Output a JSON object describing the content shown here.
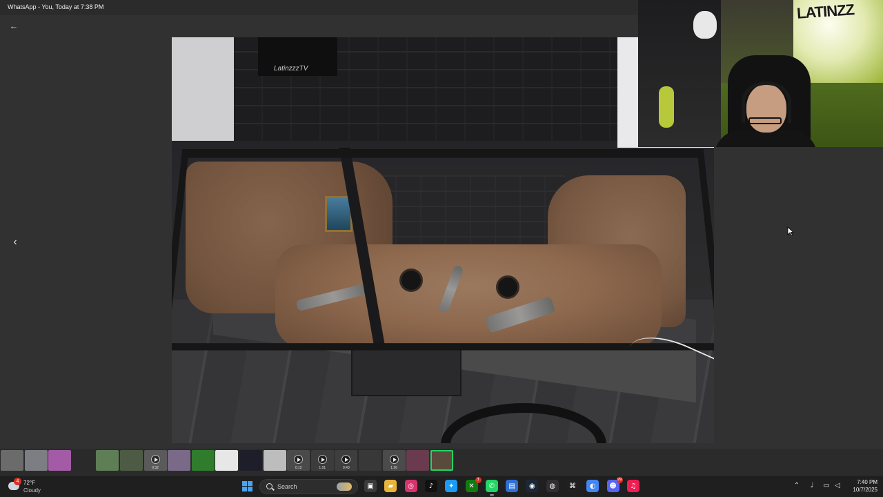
{
  "window": {
    "title": "WhatsApp - You, Today at 7:38 PM"
  },
  "viewer": {
    "back_icon": "arrow-left-icon",
    "prev_icon": "chevron-left-icon",
    "photo_poster_text": "LatinzzzTV"
  },
  "webcam": {
    "graffiti_text": "LATINZZ"
  },
  "thumbnails": [
    {
      "kind": "image",
      "color": "#6b6b6b"
    },
    {
      "kind": "image",
      "color": "#7d7d84"
    },
    {
      "kind": "image",
      "color": "#a45ba6"
    },
    {
      "kind": "image",
      "color": "#2a2a2a"
    },
    {
      "kind": "image",
      "color": "#5e7f55"
    },
    {
      "kind": "image",
      "color": "#4d5b44"
    },
    {
      "kind": "video",
      "duration": "0:32",
      "color": "#5a5a5a"
    },
    {
      "kind": "image",
      "color": "#7a6a88"
    },
    {
      "kind": "image",
      "color": "#2f7d2c"
    },
    {
      "kind": "image",
      "color": "#e7e7e7"
    },
    {
      "kind": "image",
      "color": "#1e1e2a"
    },
    {
      "kind": "image",
      "color": "#bdbdbd"
    },
    {
      "kind": "video",
      "duration": "0:12",
      "color": "#4a4a4a"
    },
    {
      "kind": "video",
      "duration": "1:01",
      "color": "#3c3c3c"
    },
    {
      "kind": "video",
      "duration": "0:43",
      "color": "#3e3e3e"
    },
    {
      "kind": "image",
      "color": "#383838"
    },
    {
      "kind": "video",
      "duration": "1:26",
      "color": "#4b4b4b"
    },
    {
      "kind": "image",
      "color": "#6a3a4f"
    },
    {
      "kind": "image",
      "color": "#5a4a3c",
      "selected": true
    }
  ],
  "taskbar": {
    "weather": {
      "badge": "4",
      "temp": "72°F",
      "condition": "Cloudy"
    },
    "search": {
      "placeholder": "Search"
    },
    "apps": [
      {
        "name": "task-view-icon",
        "glyph": "▣",
        "color": "#3a3a3a"
      },
      {
        "name": "file-explorer-icon",
        "glyph": "▰",
        "color": "#e9b43a"
      },
      {
        "name": "instagram-icon",
        "glyph": "◎",
        "color": "#d6336c"
      },
      {
        "name": "tiktok-icon",
        "glyph": "♪",
        "color": "#111111"
      },
      {
        "name": "twitter-icon",
        "glyph": "✦",
        "color": "#1d9bf0"
      },
      {
        "name": "xbox-icon",
        "glyph": "✕",
        "color": "#107c10",
        "badge": "3"
      },
      {
        "name": "whatsapp-icon",
        "glyph": "✆",
        "color": "#25d366",
        "active": true
      },
      {
        "name": "store-icon",
        "glyph": "▤",
        "color": "#2f6fd6"
      },
      {
        "name": "steam-icon",
        "glyph": "◉",
        "color": "#1b2838"
      },
      {
        "name": "obs-icon",
        "glyph": "◍",
        "color": "#302e31"
      },
      {
        "name": "capcut-icon",
        "glyph": "⌘",
        "color": "#202020"
      },
      {
        "name": "chrome-icon",
        "glyph": "◐",
        "color": "#4285f4"
      },
      {
        "name": "discord-icon",
        "glyph": "☻",
        "color": "#5865f2",
        "badge": "99"
      },
      {
        "name": "tiktok-studio-icon",
        "glyph": "♫",
        "color": "#ee1d52"
      }
    ],
    "tray": {
      "chevron_icon": "chevron-up-icon",
      "mic_icon": "microphone-icon",
      "network_icon": "network-icon",
      "volume_icon": "volume-icon"
    },
    "clock": {
      "time": "7:40 PM",
      "date": "10/7/2025"
    }
  }
}
